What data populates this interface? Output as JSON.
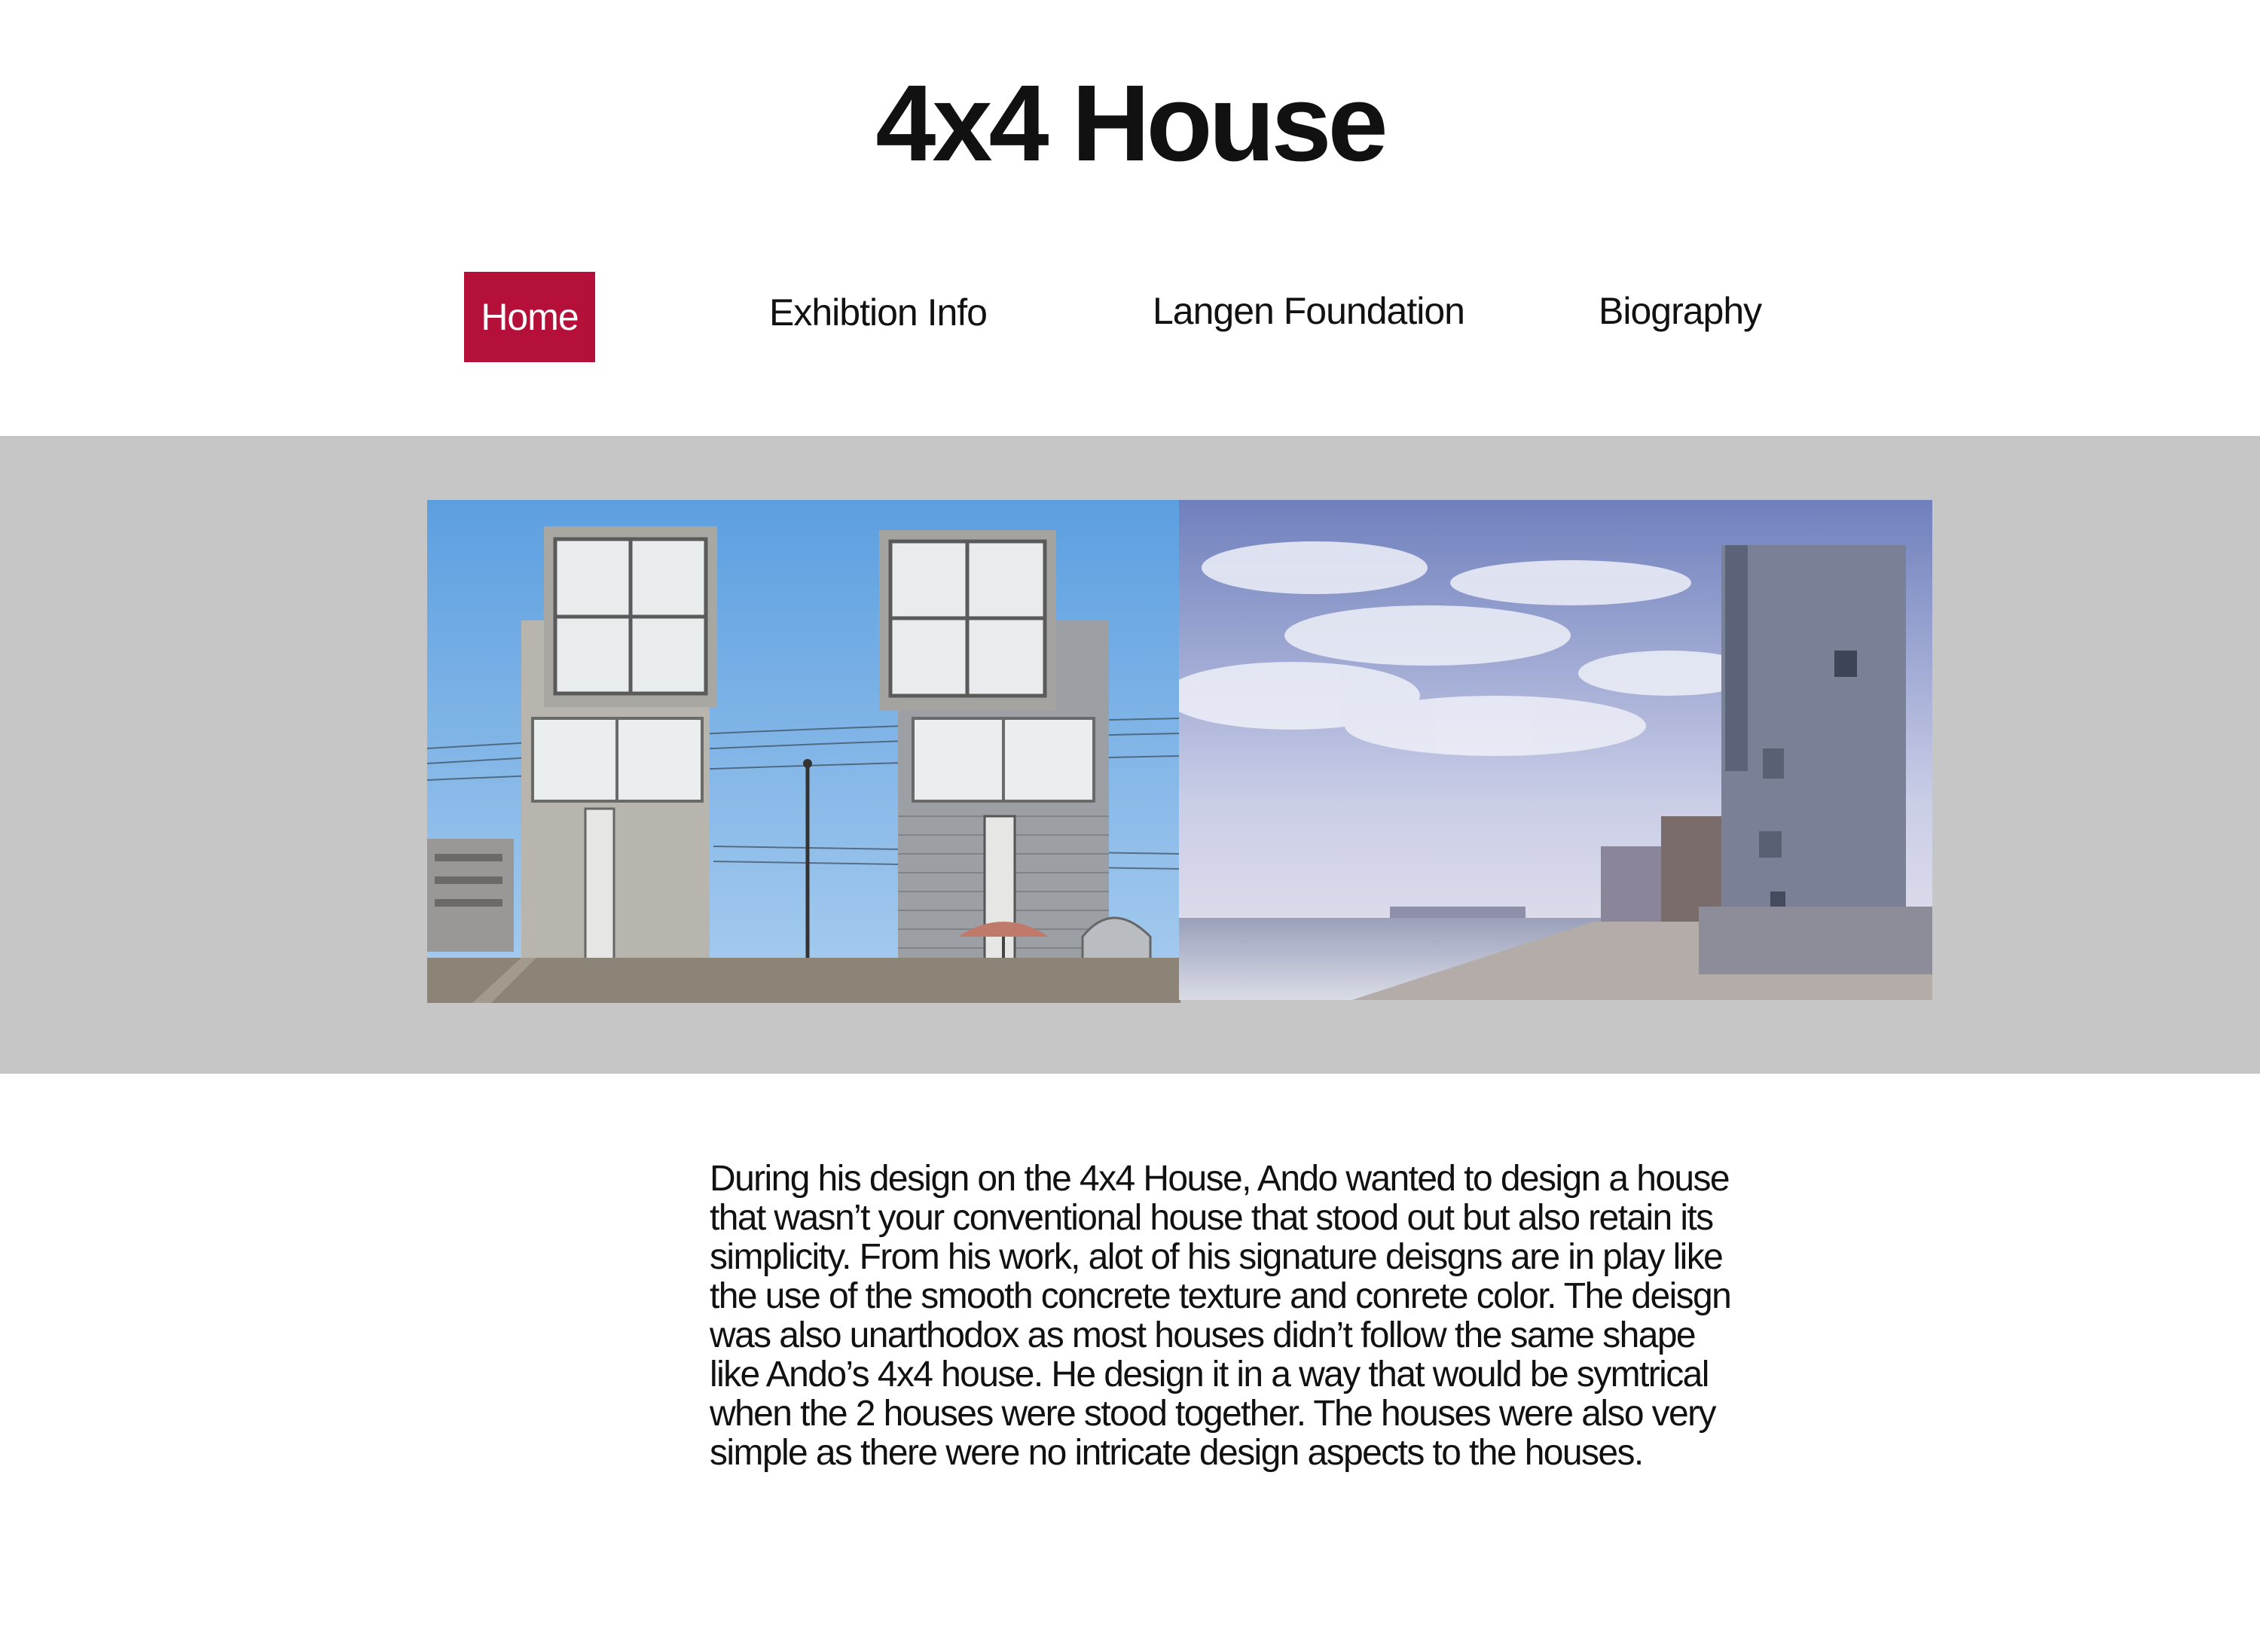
{
  "page": {
    "title": "4x4 House"
  },
  "nav": {
    "items": [
      {
        "label": "Home",
        "active": true
      },
      {
        "label": "Exhibtion Info",
        "active": false
      },
      {
        "label": "Langen Foundation",
        "active": false
      },
      {
        "label": "Biography",
        "active": false
      }
    ],
    "active_color": "#b5103a"
  },
  "gallery": {
    "background_color": "#c6c6c6"
  },
  "content": {
    "description": "During his design on the 4x4 House, Ando wanted to design a house that wasn’t your conventional house that stood out but also retain its simplicity. From his work, alot of his signature deisgns are in play like the use of the smooth concrete texture and conrete color. The deisgn was also unarthodox  as most houses didn’t follow the same shape like Ando’s 4x4 house. He design it in a way that would be symtrical when the 2 houses were stood together. The houses were also very simple as there were no intricate design aspects to the houses."
  }
}
